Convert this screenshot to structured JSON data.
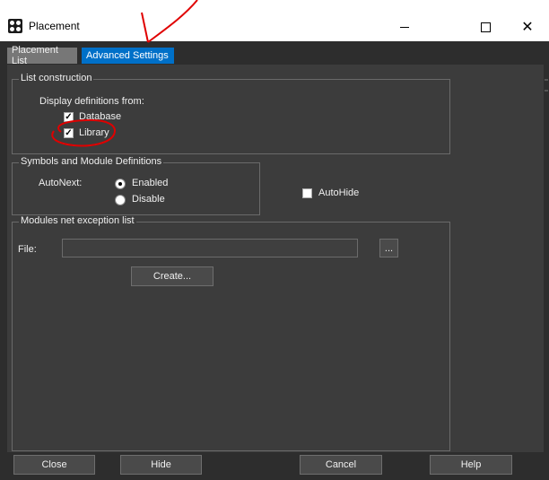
{
  "window": {
    "title": "Placement"
  },
  "tabs": [
    {
      "label": "Placement List",
      "active": false
    },
    {
      "label": "Advanced Settings",
      "active": true
    }
  ],
  "list_construction": {
    "group_label": "List construction",
    "display_label": "Display definitions from:",
    "database_label": "Database",
    "database_checked": true,
    "library_label": "Library",
    "library_checked": true
  },
  "symbols": {
    "group_label": "Symbols and Module Definitions",
    "autonext_label": "AutoNext:",
    "enabled_label": "Enabled",
    "disable_label": "Disable",
    "selected": "Enabled"
  },
  "autohide": {
    "label": "AutoHide",
    "checked": false
  },
  "modules": {
    "group_label": "Modules net exception list",
    "file_label": "File:",
    "file_value": "",
    "browse_label": "...",
    "create_label": "Create..."
  },
  "footer": {
    "close_label": "Close",
    "hide_label": "Hide",
    "cancel_label": "Cancel",
    "help_label": "Help"
  },
  "colors": {
    "accent": "#0070c8",
    "annotation": "#e00000"
  }
}
